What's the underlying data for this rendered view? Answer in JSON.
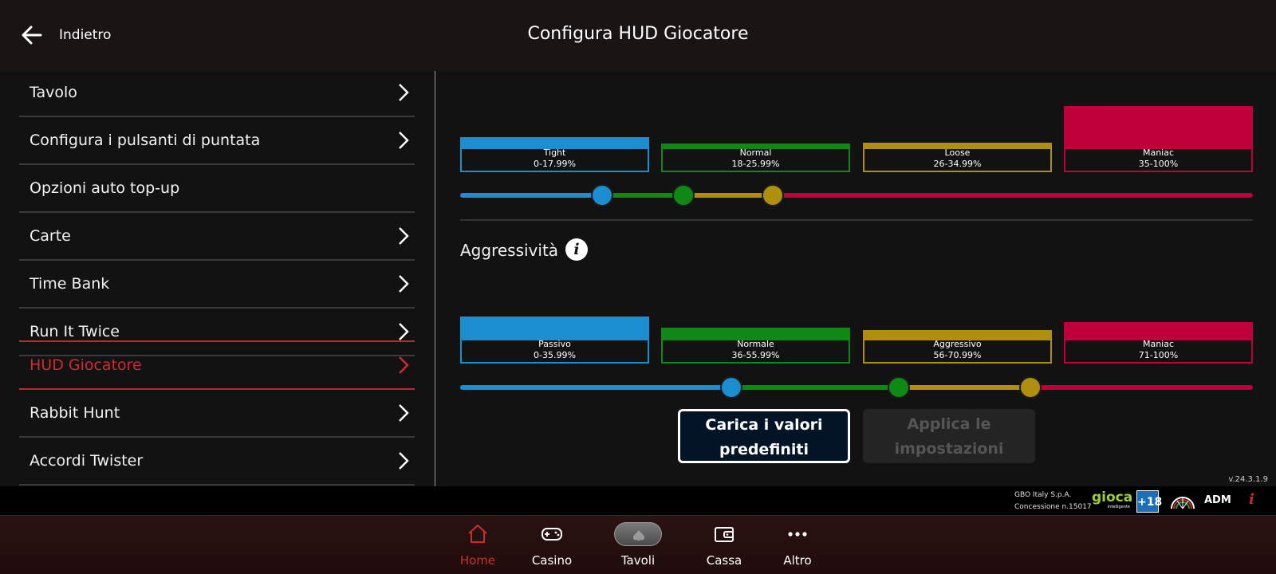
{
  "header": {
    "back_label": "Indietro",
    "title": "Configura HUD Giocatore"
  },
  "sidebar": {
    "items": [
      {
        "label": "Tavolo",
        "chevron": true,
        "active": false
      },
      {
        "label": "Configura i pulsanti di puntata",
        "chevron": true,
        "active": false
      },
      {
        "label": "Opzioni auto top-up",
        "chevron": false,
        "active": false
      },
      {
        "label": "Carte",
        "chevron": true,
        "active": false
      },
      {
        "label": "Time Bank",
        "chevron": true,
        "active": false
      },
      {
        "label": "Run It Twice",
        "chevron": true,
        "active": false
      },
      {
        "label": "HUD Giocatore",
        "chevron": true,
        "active": true
      },
      {
        "label": "Rabbit Hunt",
        "chevron": true,
        "active": false
      },
      {
        "label": "Accordi Twister",
        "chevron": true,
        "active": false
      }
    ]
  },
  "vpip": {
    "categories": [
      {
        "name": "Tight",
        "range": "0-17.99%",
        "color": "#1a8ed0"
      },
      {
        "name": "Normal",
        "range": "18-25.99%",
        "color": "#0e8a14"
      },
      {
        "name": "Loose",
        "range": "26-34.99%",
        "color": "#b08e0e"
      },
      {
        "name": "Maniac",
        "range": "35-100%",
        "color": "#c0003a"
      }
    ]
  },
  "aggression": {
    "title": "Aggressività",
    "info_icon": "info-icon",
    "categories": [
      {
        "name": "Passivo",
        "range": "0-35.99%",
        "color": "#1a8ed0"
      },
      {
        "name": "Normale",
        "range": "36-55.99%",
        "color": "#0e8a14"
      },
      {
        "name": "Aggressivo",
        "range": "56-70.99%",
        "color": "#b08e0e"
      },
      {
        "name": "Maniac",
        "range": "71-100%",
        "color": "#c0003a"
      }
    ]
  },
  "buttons": {
    "load_defaults": "Carica i valori predefiniti",
    "apply": "Applica le impostazioni"
  },
  "footer": {
    "version": "v.24.3.1.9",
    "company_line1": "GBO Italy S.p.A.",
    "company_line2": "Concessione n.15017",
    "logo_gioca": "gioca",
    "logo_gioca_sub": "intelligente",
    "logo_18": "+18",
    "logo_adm": "ADM",
    "info_symbol": "i"
  },
  "bottom_nav": {
    "items": [
      {
        "label": "Home",
        "icon": "home-icon",
        "active": true
      },
      {
        "label": "Casino",
        "icon": "gamepad-icon",
        "active": false
      },
      {
        "label": "Tavoli",
        "icon": "spade-icon",
        "active": false
      },
      {
        "label": "Cassa",
        "icon": "wallet-icon",
        "active": false
      },
      {
        "label": "Altro",
        "icon": "more-icon",
        "active": false
      }
    ]
  }
}
